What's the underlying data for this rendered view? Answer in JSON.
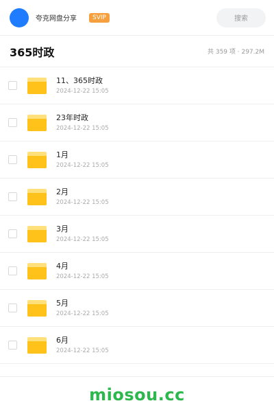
{
  "header": {
    "user_name": "夸克网盘分享",
    "badge": "SVIP",
    "search_placeholder": "搜索"
  },
  "folder": {
    "title": "365时政",
    "summary": "共 359 项 · 297.2M"
  },
  "items": [
    {
      "name": "11、365时政",
      "date": "2024-12-22 15:05"
    },
    {
      "name": "23年时政",
      "date": "2024-12-22 15:05"
    },
    {
      "name": "1月",
      "date": "2024-12-22 15:05"
    },
    {
      "name": "2月",
      "date": "2024-12-22 15:05"
    },
    {
      "name": "3月",
      "date": "2024-12-22 15:05"
    },
    {
      "name": "4月",
      "date": "2024-12-22 15:05"
    },
    {
      "name": "5月",
      "date": "2024-12-22 15:05"
    },
    {
      "name": "6月",
      "date": "2024-12-22 15:05"
    }
  ],
  "footer": {
    "watermark": "miosou.cc"
  },
  "colors": {
    "avatar": "#1f7cff",
    "svip_badge": "#f5a03c",
    "folder_icon": "#ffc21a",
    "watermark": "#2db84d"
  }
}
